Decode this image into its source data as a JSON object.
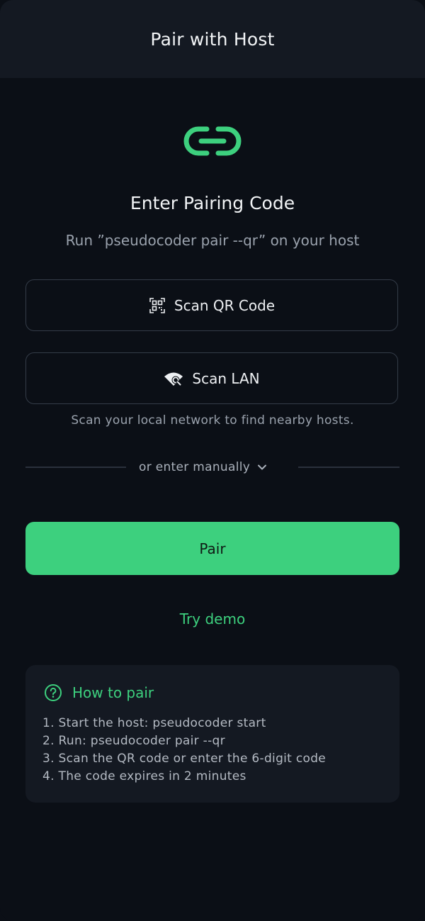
{
  "header": {
    "title": "Pair with Host"
  },
  "colors": {
    "accent": "#3dd07e",
    "background": "#0b0f16",
    "surface": "#141922",
    "border": "#343c48"
  },
  "hero": {
    "icon": "link-icon",
    "heading": "Enter Pairing Code",
    "subheading": "Run ”pseudocoder pair --qr” on your host"
  },
  "actions": {
    "scan_qr": {
      "label": "Scan QR Code",
      "icon": "qr-code-icon"
    },
    "scan_lan": {
      "label": "Scan LAN",
      "icon": "wifi-search-icon"
    },
    "lan_hint": "Scan your local network to find nearby hosts."
  },
  "manual": {
    "label": "or enter manually",
    "icon": "chevron-down-icon"
  },
  "pair_button": {
    "label": "Pair"
  },
  "demo_link": {
    "label": "Try demo"
  },
  "help": {
    "icon": "help-circle-icon",
    "title": "How to pair",
    "steps": [
      "1. Start the host: pseudocoder start",
      "2. Run: pseudocoder pair --qr",
      "3. Scan the QR code or enter the 6-digit code",
      "4. The code expires in 2 minutes"
    ]
  }
}
